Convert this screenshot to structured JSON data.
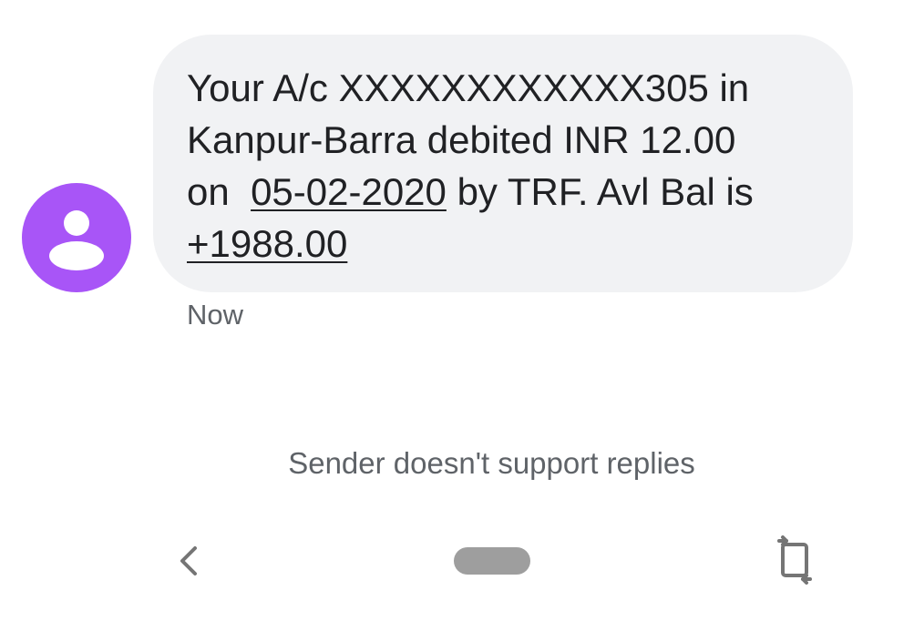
{
  "message": {
    "line1": "Your A/c XXXXXXXXXXXX305 in",
    "line2": "Kanpur-Barra debited INR 12.00",
    "line3_prefix": "on  ",
    "line3_date_link": "05-02-2020",
    "line3_suffix": " by TRF. Avl Bal is",
    "line4_amount_link": "+1988.00",
    "timestamp": "Now"
  },
  "footer": {
    "no_reply_notice": "Sender doesn't support replies"
  },
  "icons": {
    "avatar": "person-icon",
    "back": "chevron-left-icon",
    "home": "home-pill",
    "rotate": "rotate-screen-icon"
  },
  "colors": {
    "avatar_bg": "#a855f7",
    "bubble_bg": "#f1f2f4",
    "text": "#202124",
    "muted": "#5f6368",
    "nav": "#9e9e9e"
  }
}
